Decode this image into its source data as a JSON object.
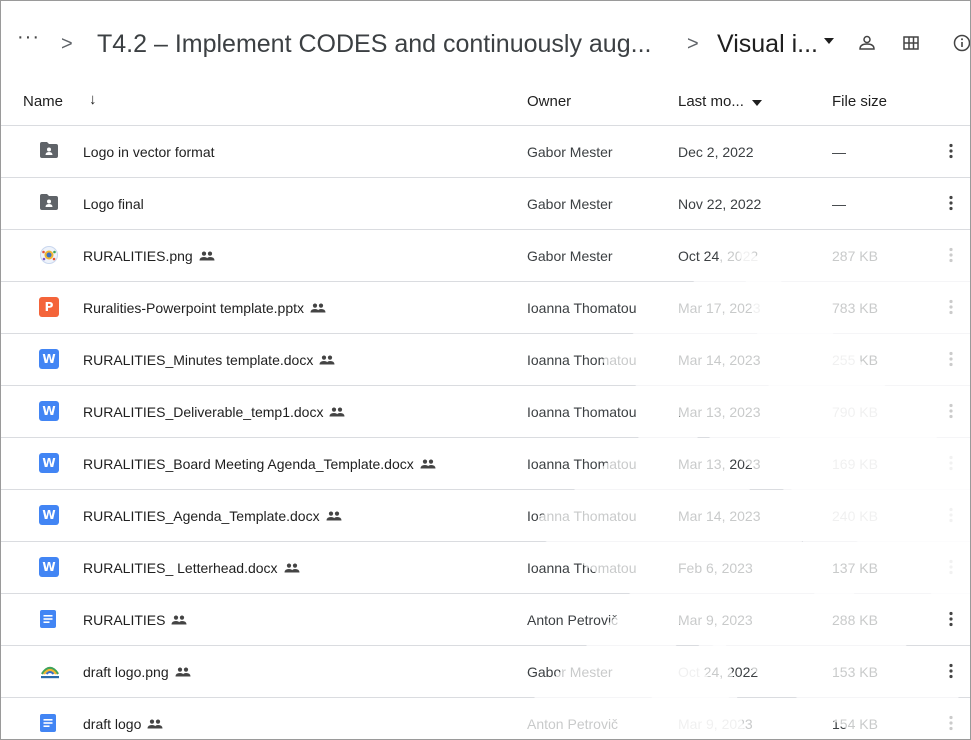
{
  "breadcrumb": {
    "more_label": "···",
    "separator": ">",
    "parent_label": "T4.2 – Implement CODES and continuously aug...",
    "current_label": "Visual i..."
  },
  "toolbar_icons": [
    "people-icon",
    "grid-view-icon",
    "info-icon"
  ],
  "columns": {
    "name": "Name",
    "sort_arrow": "↓",
    "owner": "Owner",
    "last_modified": "Last mo...",
    "file_size": "File size"
  },
  "files": [
    {
      "name": "Logo in vector format",
      "icon": "shared-folder-icon",
      "shared": false,
      "owner": "Gabor Mester",
      "modified": "Dec 2, 2022",
      "size": "—"
    },
    {
      "name": " Logo final",
      "icon": "shared-folder-icon",
      "shared": false,
      "owner": "Gabor Mester",
      "modified": "Nov 22, 2022",
      "size": "—"
    },
    {
      "name": "RURALITIES.png",
      "icon": "image-thumbnail-icon",
      "shared": true,
      "owner": "Gabor Mester",
      "modified": "Oct 24, 2022",
      "size": "287 KB"
    },
    {
      "name": "Ruralities-Powerpoint template.pptx",
      "icon": "powerpoint-icon",
      "shared": true,
      "owner": "Ioanna Thomatou",
      "modified": "Mar 17, 2023",
      "size": "783 KB"
    },
    {
      "name": "RURALITIES_Minutes template.docx",
      "icon": "word-icon",
      "shared": true,
      "owner": "Ioanna Thomatou",
      "modified": "Mar 14, 2023",
      "size": "255 KB"
    },
    {
      "name": "RURALITIES_Deliverable_temp1.docx",
      "icon": "word-icon",
      "shared": true,
      "owner": "Ioanna Thomatou",
      "modified": "Mar 13, 2023",
      "size": "790 KB"
    },
    {
      "name": "RURALITIES_Board Meeting Agenda_Template.docx",
      "icon": "word-icon",
      "shared": true,
      "owner": "Ioanna Thomatou",
      "modified": "Mar 13, 2023",
      "size": "169 KB"
    },
    {
      "name": "RURALITIES_Agenda_Template.docx",
      "icon": "word-icon",
      "shared": true,
      "owner": "Ioanna Thomatou",
      "modified": "Mar 14, 2023",
      "size": "240 KB"
    },
    {
      "name": "RURALITIES_ Letterhead.docx",
      "icon": "word-icon",
      "shared": true,
      "owner": "Ioanna Thomatou",
      "modified": "Feb 6, 2023",
      "size": "137 KB"
    },
    {
      "name": "RURALITIES",
      "icon": "google-docs-icon",
      "shared": true,
      "owner": "Anton Petrovič",
      "modified": "Mar 9, 2023",
      "size": "288 KB"
    },
    {
      "name": "draft logo.png",
      "icon": "logo-thumbnail-icon",
      "shared": true,
      "owner": "Gabor Mester",
      "modified": "Oct 24, 2022",
      "size": "153 KB"
    },
    {
      "name": "draft logo",
      "icon": "google-docs-icon",
      "shared": true,
      "owner": "Anton Petrovič",
      "modified": "Mar 9, 2023",
      "size": "154 KB"
    }
  ],
  "colors": {
    "word": "#4285f4",
    "powerpoint": "#f4643a",
    "google_docs": "#4285f4",
    "folder": "#5f6368",
    "divider": "#dadce0"
  }
}
